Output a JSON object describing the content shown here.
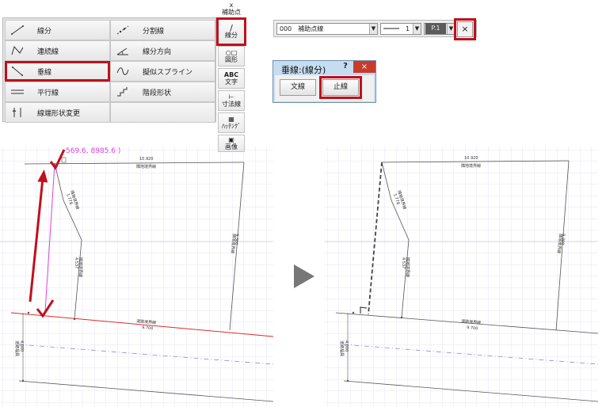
{
  "menu": {
    "items": [
      {
        "icon": "line-segment-icon",
        "label": "線分"
      },
      {
        "icon": "divided-line-icon",
        "label": "分割線"
      },
      {
        "icon": "polyline-icon",
        "label": "連続線"
      },
      {
        "icon": "line-direction-icon",
        "label": "線分方向"
      },
      {
        "icon": "perpendicular-line-icon",
        "label": "垂線"
      },
      {
        "icon": "pseudo-spline-icon",
        "label": "擬似スプライン"
      },
      {
        "icon": "parallel-line-icon",
        "label": "平行線"
      },
      {
        "icon": "staircase-line-icon",
        "label": "階段形状"
      },
      {
        "icon": "line-end-shape-icon",
        "label": "線端形状変更"
      },
      {
        "icon": "",
        "label": ""
      }
    ],
    "selected_label": "垂線"
  },
  "vtoolbar": {
    "items": [
      {
        "icon": "x",
        "label": "補助点"
      },
      {
        "icon": "/",
        "label": "線分"
      },
      {
        "icon": "○□",
        "label": "図形"
      },
      {
        "icon": "ABC",
        "label": "文字"
      },
      {
        "icon": "⊢",
        "label": "寸法線"
      },
      {
        "icon": "▦",
        "label": "ﾊｯﾁﾝｸﾞ"
      },
      {
        "icon": "▣",
        "label": "画像"
      }
    ],
    "active_label": "線分"
  },
  "propbar": {
    "layer_value": "000　補助点線",
    "line_width": "1",
    "pen": "P.1",
    "close_symbol": "×"
  },
  "dialog": {
    "title": "垂線:(線分)",
    "help": "?",
    "close": "×",
    "buttons": [
      "文線",
      "止線"
    ],
    "active_button": "止線"
  },
  "canvas": {
    "cursor_coord": "569.6, 8985.6 )",
    "labels": {
      "top_len": "10.920",
      "top_name": "隣地境界線",
      "left_len": "1.778",
      "left_name": "隣地境界線",
      "mid_len": "4.537",
      "mid_name": "隣地境界線",
      "right_len": "9.300",
      "right_name": "隣地境界線",
      "bottom_len": "9.700",
      "bottom_name": "道路境界線",
      "road_len": "4.000",
      "road_name": "道路幅員"
    }
  },
  "colors": {
    "highlight": "#c0101c",
    "magenta": "#e040e0",
    "grid": "#d9d9f2",
    "red_line": "#e02a2a"
  }
}
